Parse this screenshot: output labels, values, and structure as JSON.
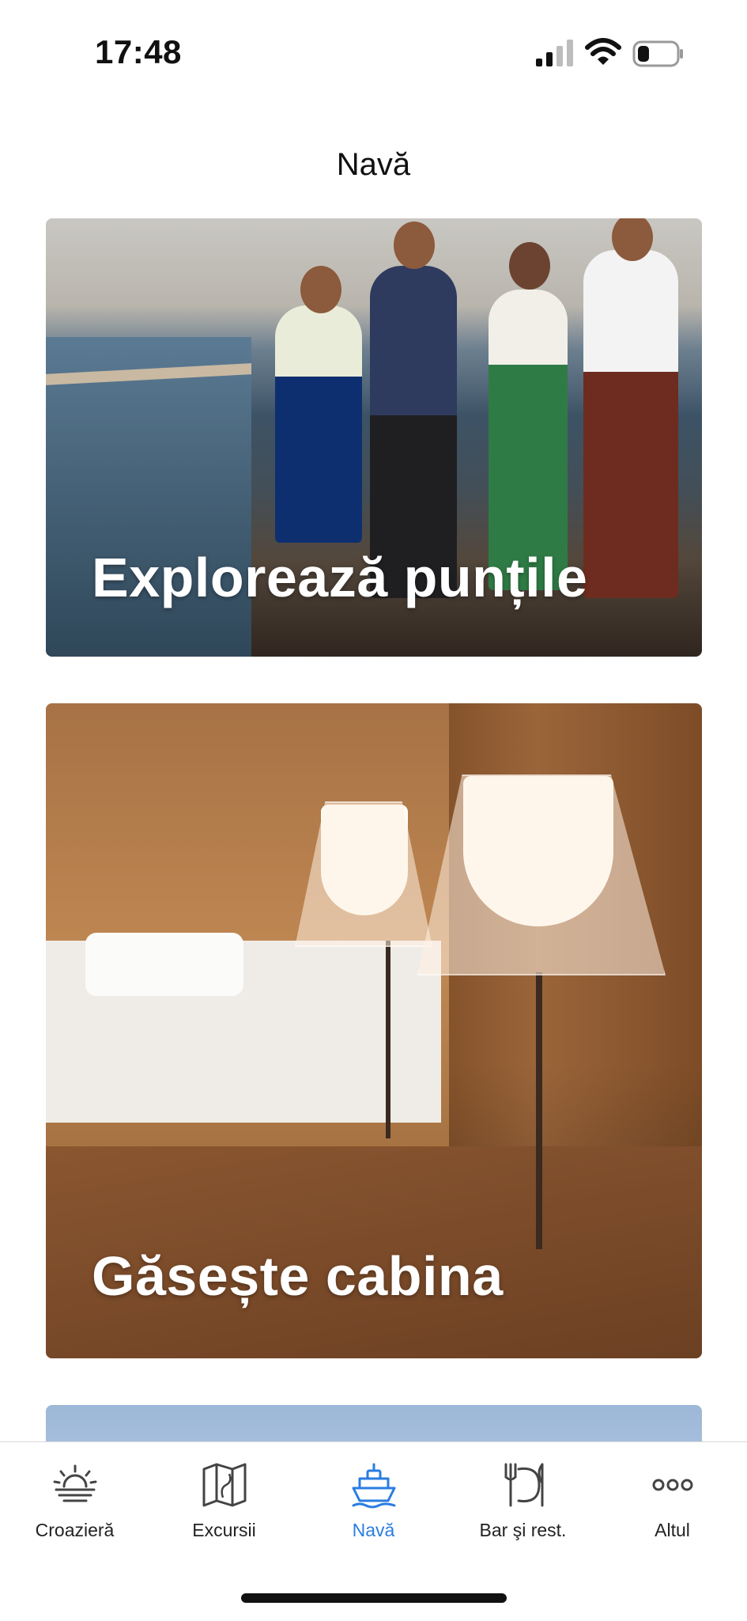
{
  "status_bar": {
    "time": "17:48",
    "signal_icon": "cellular-signal-icon",
    "wifi_icon": "wifi-icon",
    "battery_icon": "battery-icon"
  },
  "header": {
    "title": "Navă"
  },
  "cards": [
    {
      "title": "Explorează punțile"
    },
    {
      "title": "Găsește cabina"
    },
    {
      "title": ""
    }
  ],
  "tab_bar": {
    "active_color": "#2a7de1",
    "inactive_color": "#222222",
    "tabs": [
      {
        "label": "Croazieră",
        "icon": "sunset-icon"
      },
      {
        "label": "Excursii",
        "icon": "map-icon"
      },
      {
        "label": "Navă",
        "icon": "ship-icon",
        "active": true
      },
      {
        "label": "Bar şi rest.",
        "icon": "dining-icon"
      },
      {
        "label": "Altul",
        "icon": "more-icon"
      }
    ]
  }
}
